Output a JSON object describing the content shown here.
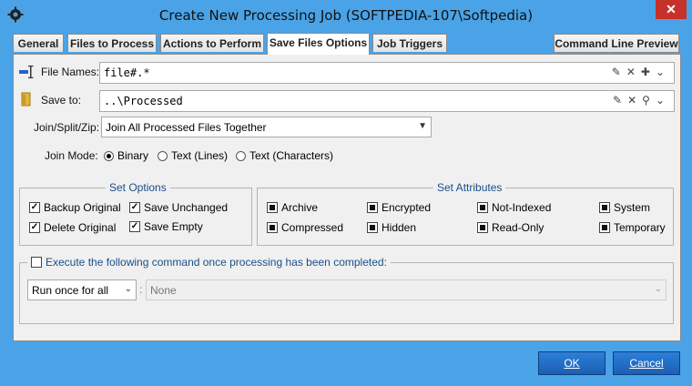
{
  "window": {
    "title": "Create New Processing Job (SOFTPEDIA-107\\Softpedia)",
    "close_label": "✕"
  },
  "tabs": [
    {
      "label": "General"
    },
    {
      "label": "Files to Process"
    },
    {
      "label": "Actions to Perform"
    },
    {
      "label": "Save Files Options",
      "active": true
    },
    {
      "label": "Job Triggers"
    }
  ],
  "command_line_preview_label": "Command Line Preview",
  "file_names": {
    "label": "File Names:",
    "value": "file#.*"
  },
  "save_to": {
    "label": "Save to:",
    "value": "..\\Processed"
  },
  "join_split_zip": {
    "label": "Join/Split/Zip:",
    "value": "Join All Processed Files Together"
  },
  "join_mode": {
    "label": "Join Mode:",
    "options": [
      {
        "label": "Binary",
        "selected": true
      },
      {
        "label": "Text (Lines)",
        "selected": false
      },
      {
        "label": "Text (Characters)",
        "selected": false
      }
    ]
  },
  "set_options": {
    "title": "Set Options",
    "items": [
      {
        "label": "Backup Original",
        "checked": true
      },
      {
        "label": "Save Unchanged",
        "checked": true
      },
      {
        "label": "Delete Original",
        "checked": true
      },
      {
        "label": "Save Empty",
        "checked": true
      }
    ]
  },
  "set_attributes": {
    "title": "Set Attributes",
    "items": [
      "Archive",
      "Encrypted",
      "Not-Indexed",
      "System",
      "Compressed",
      "Hidden",
      "Read-Only",
      "Temporary"
    ]
  },
  "execute": {
    "label": "Execute the following command once processing has been completed:",
    "mode_value": "Run once for all",
    "command_value": "None",
    "separator": ":"
  },
  "buttons": {
    "ok": "OK",
    "cancel": "Cancel"
  },
  "colors": {
    "window": "#4aa3e6",
    "panel": "#f0f0f0",
    "group_title": "#1a4f8a",
    "button": "#1c5fb3",
    "close": "#c7312b"
  }
}
